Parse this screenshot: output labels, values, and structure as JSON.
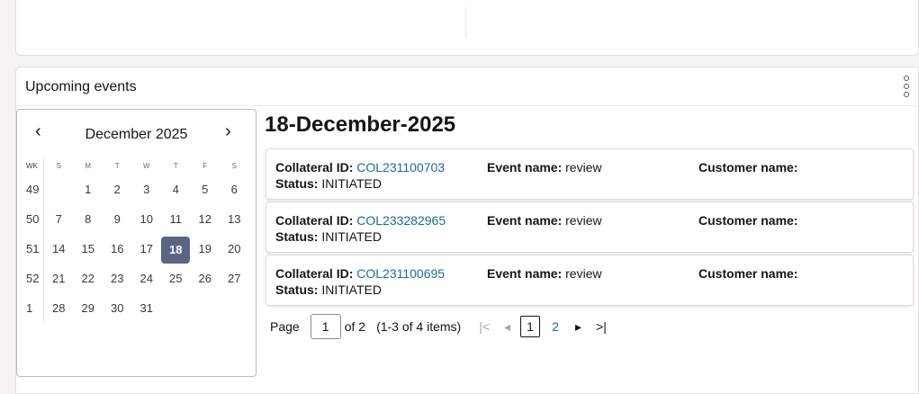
{
  "section": {
    "title": "Upcoming events"
  },
  "calendar": {
    "month_label": "December 2025",
    "prev_icon": "‹",
    "next_icon": "›",
    "headers": [
      "WK",
      "S",
      "M",
      "T",
      "W",
      "T",
      "F",
      "S"
    ],
    "weeks": [
      {
        "wk": "49",
        "days": [
          "",
          "1",
          "2",
          "3",
          "4",
          "5",
          "6"
        ]
      },
      {
        "wk": "50",
        "days": [
          "7",
          "8",
          "9",
          "10",
          "11",
          "12",
          "13"
        ]
      },
      {
        "wk": "51",
        "days": [
          "14",
          "15",
          "16",
          "17",
          "18",
          "19",
          "20"
        ]
      },
      {
        "wk": "52",
        "days": [
          "21",
          "22",
          "23",
          "24",
          "25",
          "26",
          "27"
        ]
      },
      {
        "wk": "1",
        "days": [
          "28",
          "29",
          "30",
          "31",
          "",
          "",
          ""
        ]
      }
    ],
    "selected_day": "18"
  },
  "selected_date_heading": "18-December-2025",
  "labels": {
    "collateral_id": "Collateral ID:",
    "event_name": "Event name:",
    "customer_name": "Customer name:",
    "status": "Status:"
  },
  "events": [
    {
      "collateral_id": "COL231100703",
      "event_name": "review",
      "customer_name": "",
      "status": "INITIATED"
    },
    {
      "collateral_id": "COL233282965",
      "event_name": "review",
      "customer_name": "",
      "status": "INITIATED"
    },
    {
      "collateral_id": "COL231100695",
      "event_name": "review",
      "customer_name": "",
      "status": "INITIATED"
    }
  ],
  "pagination": {
    "page_label": "Page",
    "current_page": "1",
    "of_label": "of 2",
    "items_label": "(1-3 of 4 items)",
    "pages": [
      "1",
      "2"
    ],
    "first_icon": "|<",
    "prev_icon": "◂",
    "next_icon": "▸",
    "last_icon": ">|"
  }
}
